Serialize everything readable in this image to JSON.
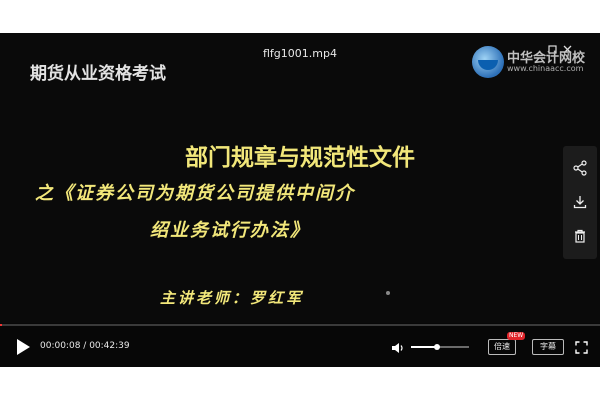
{
  "player": {
    "file_title": "flfg1001.mp4",
    "top_icons": [
      "restore-icon",
      "close-icon"
    ]
  },
  "video_frame": {
    "course_label": "期货从业资格考试",
    "logo": {
      "name": "中华会计网校",
      "url": "www.chinaacc.com"
    },
    "headline": "部门规章与规范性文件",
    "subtitle_line1": "之《证券公司为期货公司提供中间介",
    "subtitle_line2": "绍业务试行办法》",
    "lecturer": "主讲老师：罗红军",
    "text_color": "#f2e77a"
  },
  "side_panel": {
    "buttons": [
      "share-icon",
      "download-icon",
      "delete-icon"
    ]
  },
  "controls": {
    "current_time": "00:00:08",
    "separator": " / ",
    "duration": "00:42:39",
    "progress_fraction": 0.003,
    "volume_fraction": 0.45,
    "speed_label": "倍速",
    "speed_badge": "NEW",
    "caption_label": "字幕",
    "accent_color": "#e33"
  }
}
